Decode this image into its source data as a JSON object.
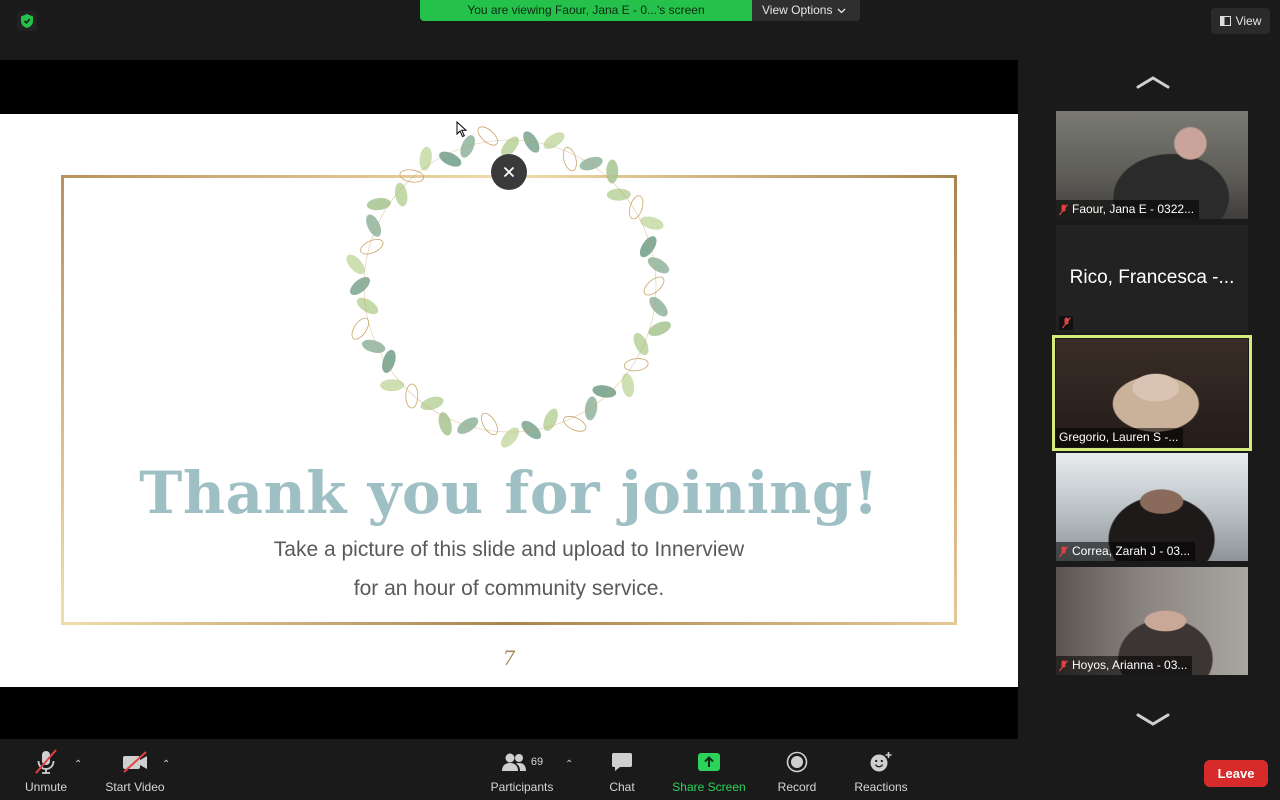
{
  "banner": {
    "viewing_text": "You are viewing Faour, Jana E - 0...'s screen",
    "view_options": "View Options"
  },
  "view_button": "View",
  "slide": {
    "title": "Thank you for joining!",
    "subtitle_line1": "Take a picture of this slide and upload to Innerview",
    "subtitle_line2": "for an hour of community service.",
    "page_number": "7"
  },
  "gallery": {
    "participants": [
      {
        "name": "Faour, Jana E - 0322...",
        "muted": true,
        "video": true,
        "active": false
      },
      {
        "name": "Rico, Francesca -...",
        "muted": true,
        "video": false,
        "active": false
      },
      {
        "name": "Gregorio, Lauren S -...",
        "muted": false,
        "video": true,
        "active": true
      },
      {
        "name": "Correa, Zarah J - 03...",
        "muted": true,
        "video": true,
        "active": false
      },
      {
        "name": "Hoyos, Arianna - 03...",
        "muted": true,
        "video": true,
        "active": false
      }
    ]
  },
  "toolbar": {
    "unmute": "Unmute",
    "start_video": "Start Video",
    "participants": "Participants",
    "participant_count": "69",
    "chat": "Chat",
    "share_screen": "Share Screen",
    "record": "Record",
    "reactions": "Reactions",
    "leave": "Leave"
  },
  "colors": {
    "banner_green": "#24c24a",
    "share_green": "#2dd25a",
    "leave_red": "#d72b2b",
    "active_speaker": "#d6ec7a",
    "slide_title": "#9ebfc4",
    "frame_gold": "#c9a56a"
  }
}
